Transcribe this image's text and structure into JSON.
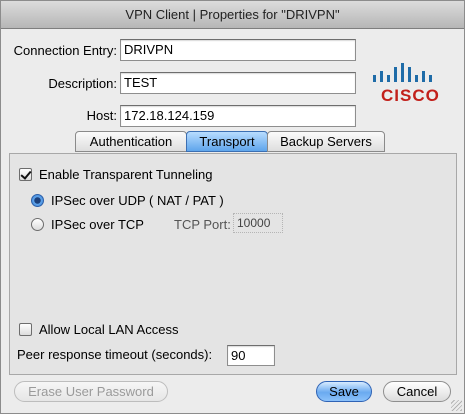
{
  "window": {
    "title": "VPN Client  |  Properties for \"DRIVPN\""
  },
  "form": {
    "connection_entry_label": "Connection Entry:",
    "connection_entry_value": "DRIVPN",
    "description_label": "Description:",
    "description_value": "TEST",
    "host_label": "Host:",
    "host_value": "172.18.124.159"
  },
  "logo": {
    "word": "CISCO"
  },
  "tabs": [
    {
      "label": "Authentication",
      "active": false
    },
    {
      "label": "Transport",
      "active": true
    },
    {
      "label": "Backup Servers",
      "active": false
    }
  ],
  "transport": {
    "enable_transparent_tunneling_label": "Enable Transparent Tunneling",
    "enable_transparent_tunneling_checked": true,
    "ipsec_udp_label": "IPSec over UDP ( NAT / PAT )",
    "ipsec_udp_selected": true,
    "ipsec_tcp_label": "IPSec over TCP",
    "ipsec_tcp_selected": false,
    "tcp_port_label": "TCP Port:",
    "tcp_port_value": "10000",
    "allow_local_lan_label": "Allow Local LAN Access",
    "allow_local_lan_checked": false,
    "peer_timeout_label": "Peer response timeout (seconds):",
    "peer_timeout_value": "90"
  },
  "buttons": {
    "erase_user_password": "Erase User Password",
    "save": "Save",
    "cancel": "Cancel"
  },
  "colors": {
    "logo_red": "#c2201b",
    "logo_blue": "#1f6ca8",
    "tab_active": "#5fa5ec",
    "default_button": "#6aaaf0"
  }
}
